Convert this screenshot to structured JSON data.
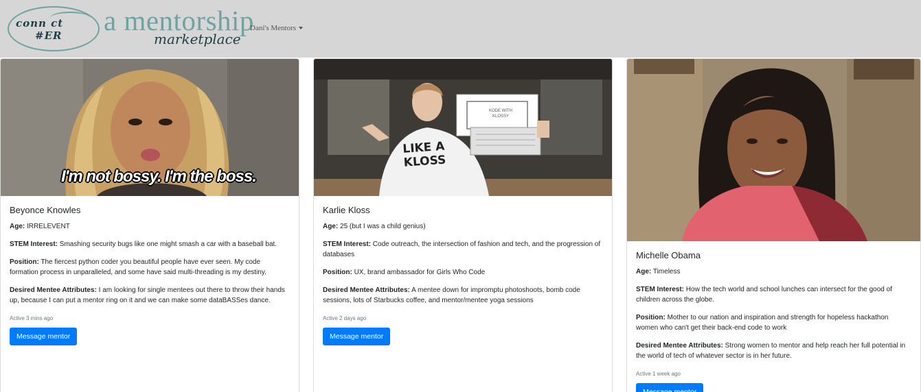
{
  "navbar": {
    "logo_line1": "conn ct",
    "logo_line2": "#ER",
    "tagline_main": "a mentorship",
    "tagline_sub": "marketplace",
    "dropdown_label": "Dani's Mentors"
  },
  "colors": {
    "navbar_bg": "#d6d6d6",
    "brand_teal": "#6fa3a2",
    "brand_dark": "#1c3f46",
    "button_primary": "#007bff"
  },
  "cards": [
    {
      "name": "Beyonce Knowles",
      "image_caption": "I'm not bossy. I'm the boss.",
      "age_label": "Age:",
      "age": "IRRELEVENT",
      "stem_label": "STEM Interest:",
      "stem": "Smashing security bugs like one might smash a car with a baseball bat.",
      "position_label": "Position:",
      "position": "The fiercest python coder you beautiful people have ever seen. My code formation process in unparalleled, and some have said multi-threading is my destiny.",
      "attributes_label": "Desired Mentee Attributes:",
      "attributes": "I am looking for single mentees out there to throw their hands up, because I can put a mentor ring on it and we can make some dataBASSes dance.",
      "active": "Active 3 mins ago",
      "button": "Message mentor"
    },
    {
      "name": "Karlie Kloss",
      "image_caption": "LIKE A KLOSS",
      "box_text": "KODE WITH KLOSSY",
      "age_label": "Age:",
      "age": "25 (but I was a child genius)",
      "stem_label": "STEM Interest:",
      "stem": "Code outreach, the intersection of fashion and tech, and the progression of databases",
      "position_label": "Position:",
      "position": "UX, brand ambassador for Girls Who Code",
      "attributes_label": "Desired Mentee Attributes:",
      "attributes": "A mentee down for impromptu photoshoots, bomb code sessions, lots of Starbucks coffee, and mentor/mentee yoga sessions",
      "active": "Active 2 days ago",
      "button": "Message mentor"
    },
    {
      "name": "Michelle Obama",
      "age_label": "Age:",
      "age": "Timeless",
      "stem_label": "STEM Interest:",
      "stem": "How the tech world and school lunches can intersect for the good of children across the globe.",
      "position_label": "Position:",
      "position": "Mother to our nation and inspiration and strength for hopeless hackathon women who can't get their back-end code to work",
      "attributes_label": "Desired Mentee Attributes:",
      "attributes": "Strong women to mentor and help reach her full potential in the world of tech of whatever sector is in her future.",
      "active": "Active 1 week ago",
      "button": "Message mentor"
    }
  ]
}
